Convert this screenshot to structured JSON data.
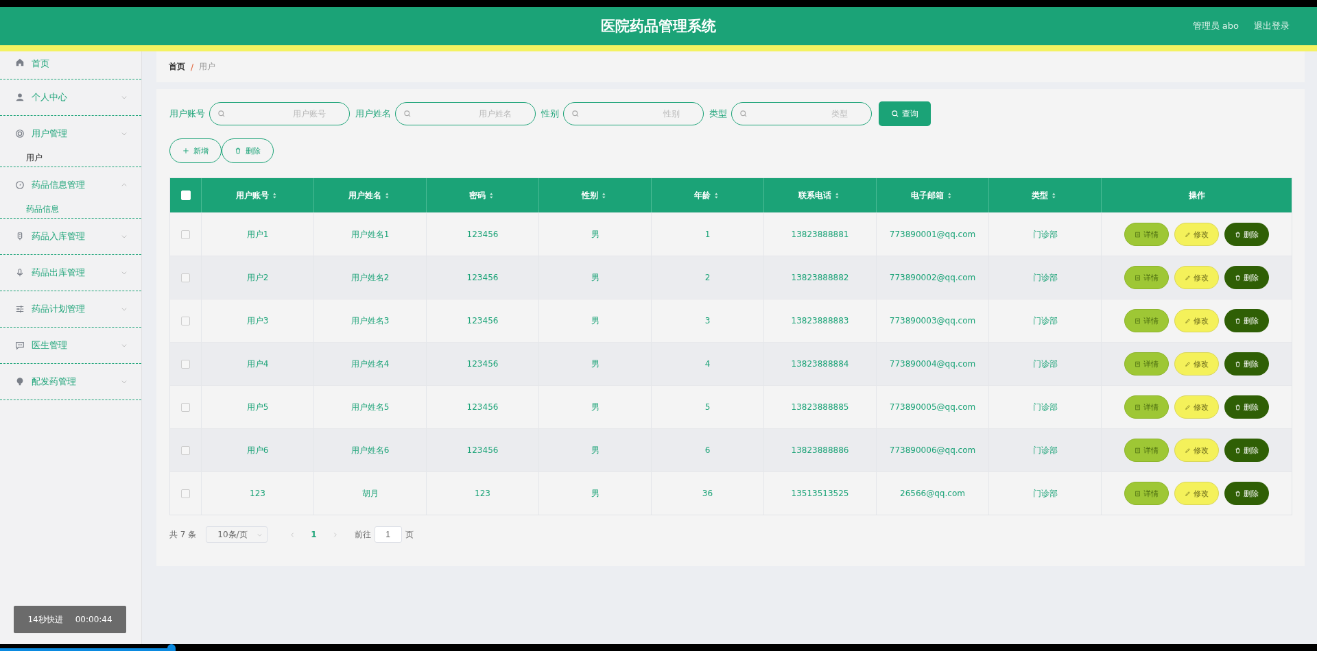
{
  "header": {
    "title": "医院药品管理系统",
    "user": "管理员 abo",
    "logout": "退出登录"
  },
  "sidebar": {
    "items": [
      {
        "label": "首页",
        "selected": false
      },
      {
        "label": "个人中心",
        "expanded": false,
        "selected": false
      },
      {
        "label": "用户管理",
        "expanded": false,
        "selected": false,
        "children": [
          {
            "label": "用户",
            "selected": true
          }
        ]
      },
      {
        "label": "药品信息管理",
        "expanded": true,
        "selected": false,
        "children": [
          {
            "label": "药品信息",
            "selected": false
          }
        ]
      },
      {
        "label": "药品入库管理",
        "expanded": false,
        "selected": false
      },
      {
        "label": "药品出库管理",
        "expanded": false,
        "selected": false
      },
      {
        "label": "药品计划管理",
        "expanded": false,
        "selected": false
      },
      {
        "label": "医生管理",
        "expanded": false,
        "selected": false
      },
      {
        "label": "配发药管理",
        "expanded": false,
        "selected": false
      }
    ]
  },
  "breadcrumb": {
    "items": [
      "首页",
      "用户"
    ],
    "separator": "/"
  },
  "search": {
    "fields": [
      {
        "label": "用户账号",
        "placeholder": "用户账号"
      },
      {
        "label": "用户姓名",
        "placeholder": "用户姓名"
      },
      {
        "label": "性别",
        "placeholder": "性别"
      },
      {
        "label": "类型",
        "placeholder": "类型"
      }
    ],
    "button": "查询"
  },
  "actions": [
    {
      "kind": "add",
      "label": "新增"
    },
    {
      "kind": "delete",
      "label": "删除"
    }
  ],
  "table": {
    "select_all_checked": false,
    "columns": [
      {
        "label": "用户账号",
        "sortable": true
      },
      {
        "label": "用户姓名",
        "sortable": true
      },
      {
        "label": "密码",
        "sortable": true
      },
      {
        "label": "性别",
        "sortable": true
      },
      {
        "label": "年龄",
        "sortable": true
      },
      {
        "label": "联系电话",
        "sortable": true
      },
      {
        "label": "电子邮箱",
        "sortable": true
      },
      {
        "label": "类型",
        "sortable": true
      },
      {
        "label": "操作",
        "sortable": false
      }
    ],
    "rows": [
      {
        "checked": false,
        "cells": [
          "用户1",
          "用户姓名1",
          "123456",
          "男",
          "1",
          "13823888881",
          "773890001@qq.com",
          "门诊部"
        ],
        "buttons": [
          {
            "kind": "detail",
            "label": "详情"
          },
          {
            "kind": "edit",
            "label": "修改"
          },
          {
            "kind": "delete",
            "label": "删除"
          }
        ]
      },
      {
        "checked": false,
        "cells": [
          "用户2",
          "用户姓名2",
          "123456",
          "男",
          "2",
          "13823888882",
          "773890002@qq.com",
          "门诊部"
        ],
        "buttons": [
          {
            "kind": "detail",
            "label": "详情"
          },
          {
            "kind": "edit",
            "label": "修改"
          },
          {
            "kind": "delete",
            "label": "删除"
          }
        ]
      },
      {
        "checked": false,
        "cells": [
          "用户3",
          "用户姓名3",
          "123456",
          "男",
          "3",
          "13823888883",
          "773890003@qq.com",
          "门诊部"
        ],
        "buttons": [
          {
            "kind": "detail",
            "label": "详情"
          },
          {
            "kind": "edit",
            "label": "修改"
          },
          {
            "kind": "delete",
            "label": "删除"
          }
        ]
      },
      {
        "checked": false,
        "cells": [
          "用户4",
          "用户姓名4",
          "123456",
          "男",
          "4",
          "13823888884",
          "773890004@qq.com",
          "门诊部"
        ],
        "buttons": [
          {
            "kind": "detail",
            "label": "详情"
          },
          {
            "kind": "edit",
            "label": "修改"
          },
          {
            "kind": "delete",
            "label": "删除"
          }
        ]
      },
      {
        "checked": false,
        "cells": [
          "用户5",
          "用户姓名5",
          "123456",
          "男",
          "5",
          "13823888885",
          "773890005@qq.com",
          "门诊部"
        ],
        "buttons": [
          {
            "kind": "detail",
            "label": "详情"
          },
          {
            "kind": "edit",
            "label": "修改"
          },
          {
            "kind": "delete",
            "label": "删除"
          }
        ]
      },
      {
        "checked": false,
        "cells": [
          "用户6",
          "用户姓名6",
          "123456",
          "男",
          "6",
          "13823888886",
          "773890006@qq.com",
          "门诊部"
        ],
        "buttons": [
          {
            "kind": "detail",
            "label": "详情"
          },
          {
            "kind": "edit",
            "label": "修改"
          },
          {
            "kind": "delete",
            "label": "删除"
          }
        ]
      },
      {
        "checked": false,
        "cells": [
          "123",
          "胡月",
          "123",
          "男",
          "36",
          "13513513525",
          "26566@qq.com",
          "门诊部"
        ],
        "buttons": [
          {
            "kind": "detail",
            "label": "详情"
          },
          {
            "kind": "edit",
            "label": "修改"
          },
          {
            "kind": "delete",
            "label": "删除"
          }
        ]
      }
    ]
  },
  "pagination": {
    "total": "共 7 条",
    "page_size": "10条/页",
    "pages": [
      {
        "label": "1",
        "selected": true
      }
    ],
    "goto_label": "前往",
    "goto_value": "1",
    "goto_suffix": "页"
  },
  "video": {
    "badge": "14秒快进",
    "time": "00:00:44",
    "progress": {
      "level": 0.13
    }
  }
}
